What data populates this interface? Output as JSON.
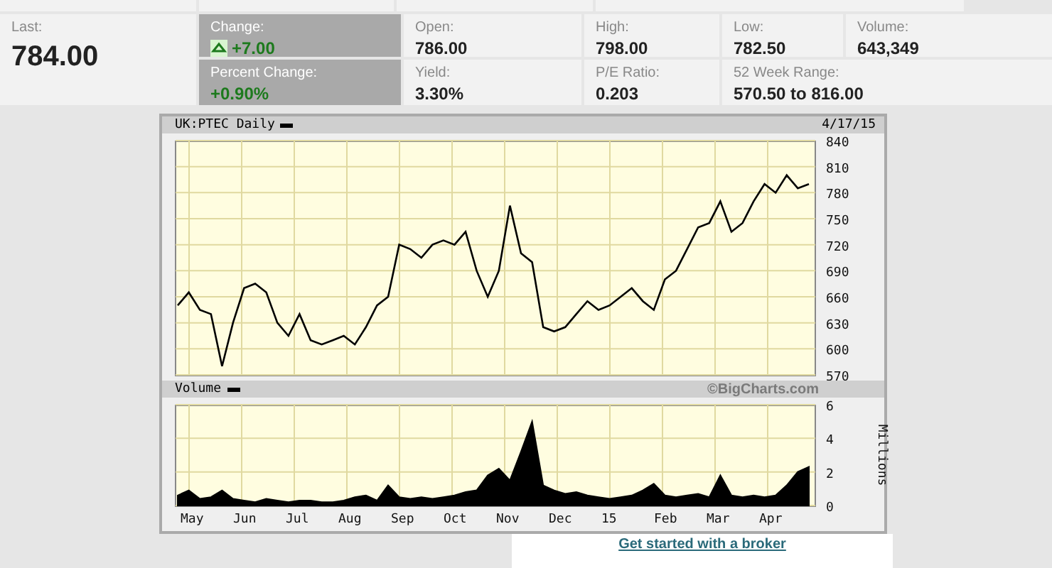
{
  "quote": {
    "last": {
      "label": "Last:",
      "value": "784.00"
    },
    "change": {
      "label": "Change:",
      "value": "+7.00",
      "up": true
    },
    "percent_change": {
      "label": "Percent Change:",
      "value": "+0.90%"
    },
    "cells": [
      {
        "label": "Open:",
        "value": "786.00",
        "wide": false
      },
      {
        "label": "High:",
        "value": "798.00",
        "wide": false
      },
      {
        "label": "Low:",
        "value": "782.50",
        "wide": false
      },
      {
        "label": "Volume:",
        "value": "643,349",
        "wide": false
      },
      {
        "label": "Yield:",
        "value": "3.30%",
        "wide": false
      },
      {
        "label": "P/E Ratio:",
        "value": "0.203",
        "wide": false
      },
      {
        "label": "52 Week Range:",
        "value": "570.50 to 816.00",
        "wide": true
      }
    ]
  },
  "chart": {
    "title": "UK:PTEC Daily",
    "date": "4/17/15",
    "volume_title": "Volume",
    "credit": "©BigCharts.com",
    "price_chart": {
      "chart_data": {
        "type": "line",
        "grid": true,
        "ylim": [
          570,
          840
        ],
        "yticks": [
          570,
          600,
          630,
          660,
          690,
          720,
          750,
          780,
          810,
          840
        ],
        "series": [
          {
            "color": "#000000",
            "values": [
              650,
              665,
              645,
              640,
              580,
              630,
              670,
              675,
              665,
              630,
              615,
              640,
              610,
              605,
              610,
              615,
              605,
              625,
              650,
              660,
              720,
              715,
              705,
              720,
              725,
              720,
              735,
              690,
              660,
              690,
              765,
              710,
              700,
              625,
              620,
              625,
              640,
              655,
              645,
              650,
              660,
              670,
              655,
              645,
              680,
              690,
              715,
              740,
              745,
              770,
              735,
              745,
              770,
              790,
              780,
              800,
              785,
              790
            ]
          }
        ]
      }
    },
    "volume_chart": {
      "month_labels": [
        "May",
        "Jun",
        "Jul",
        "Aug",
        "Sep",
        "Oct",
        "Nov",
        "Dec",
        "15",
        "Feb",
        "Mar",
        "Apr"
      ],
      "chart_data": {
        "type": "area",
        "grid": true,
        "ylabel": "Millions",
        "ylim": [
          0,
          6
        ],
        "yticks": [
          0,
          2,
          4,
          6
        ],
        "series": [
          {
            "color": "#000000",
            "values": [
              0.6,
              0.9,
              0.4,
              0.5,
              0.9,
              0.4,
              0.3,
              0.2,
              0.4,
              0.3,
              0.2,
              0.3,
              0.3,
              0.2,
              0.2,
              0.3,
              0.5,
              0.6,
              0.3,
              1.2,
              0.5,
              0.4,
              0.5,
              0.4,
              0.5,
              0.6,
              0.8,
              0.9,
              1.8,
              2.2,
              1.5,
              3.2,
              5.0,
              1.2,
              0.9,
              0.7,
              0.8,
              0.6,
              0.5,
              0.4,
              0.5,
              0.6,
              0.9,
              1.3,
              0.6,
              0.5,
              0.6,
              0.7,
              0.5,
              1.8,
              0.6,
              0.5,
              0.6,
              0.5,
              0.6,
              1.2,
              2.0,
              2.3
            ]
          }
        ]
      }
    }
  },
  "broker_link": "Get started with a broker"
}
